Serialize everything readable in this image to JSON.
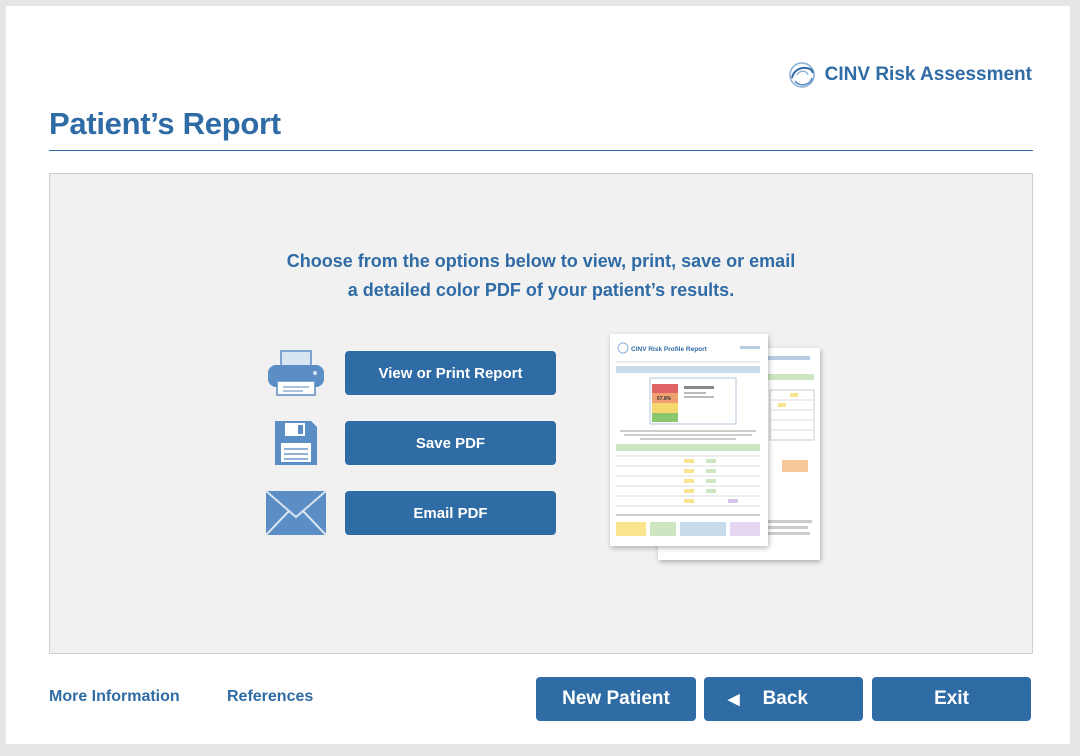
{
  "header": {
    "app_name": "CINV Risk Assessment",
    "logo_icon": "swirl-logo-icon"
  },
  "page": {
    "title": "Patient’s Report"
  },
  "main": {
    "instructions_line1": "Choose from the options below to view, print, save or email",
    "instructions_line2": "a detailed color PDF of your patient’s results.",
    "actions": [
      {
        "label": "View or Print Report",
        "icon": "printer-icon"
      },
      {
        "label": "Save PDF",
        "icon": "floppy-disk-icon"
      },
      {
        "label": "Email PDF",
        "icon": "envelope-icon"
      }
    ],
    "preview": {
      "title": "CINV Risk Profile Report",
      "score": "67.8%"
    }
  },
  "footer": {
    "links": [
      "More Information",
      "References"
    ],
    "buttons": {
      "new_patient": "New Patient",
      "back": "Back",
      "exit": "Exit"
    }
  },
  "colors": {
    "primary": "#2f6ba5",
    "panel_bg": "#f1f1f1",
    "icon_blue": "#5a8ec4"
  }
}
